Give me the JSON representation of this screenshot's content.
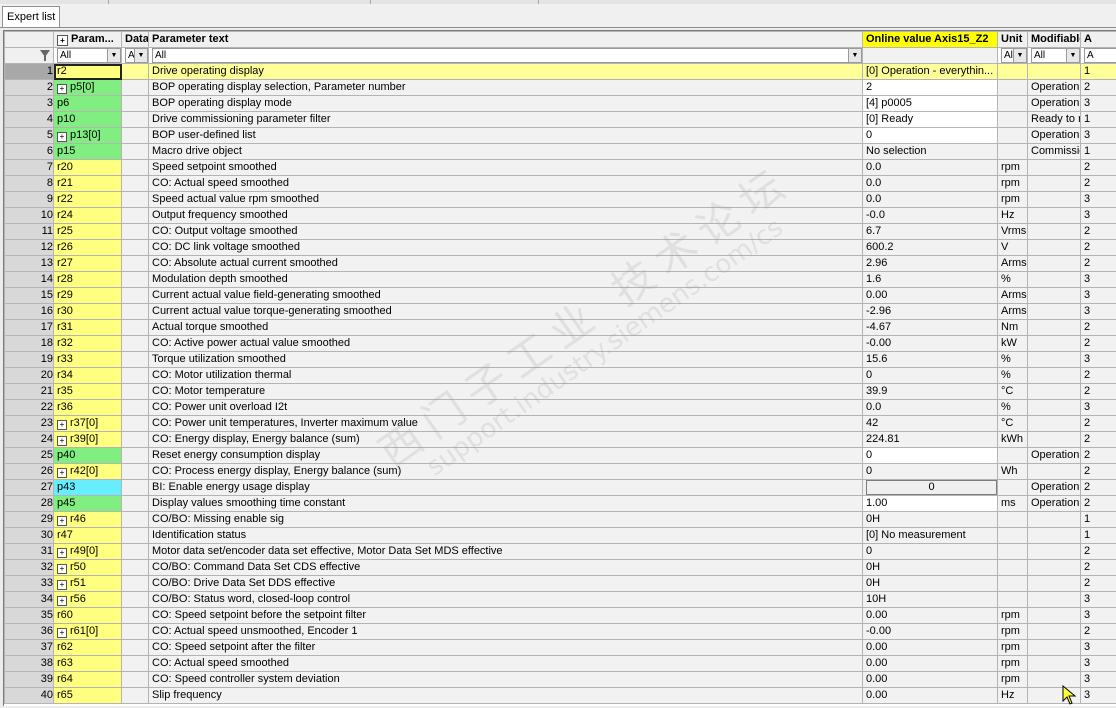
{
  "tab": {
    "label": "Expert list"
  },
  "columns": {
    "param": "Param...",
    "data": "Data",
    "text": "Parameter text",
    "online": "Online value Axis15_Z2",
    "unit": "Unit",
    "mod": "Modifiable to",
    "access": "A"
  },
  "filters": {
    "param": "All",
    "data": "A",
    "text": "All",
    "unit": "Al",
    "mod": "All",
    "access": "A"
  },
  "watermark": {
    "line1": "西门子工业 技术论坛",
    "line2": "support.industry.siemens.com/cs"
  },
  "rows": [
    {
      "n": "1",
      "p": "r2",
      "pc": "y",
      "t": "Drive operating display",
      "v": "[0] Operation - everythin...",
      "u": "",
      "m": "",
      "a": "1"
    },
    {
      "n": "2",
      "p": "p5[0]",
      "pc": "g",
      "x": "1",
      "t": "BOP operating display selection, Parameter number",
      "v": "2",
      "vw": "1",
      "u": "",
      "m": "Operation",
      "a": "2"
    },
    {
      "n": "3",
      "p": "p6",
      "pc": "g",
      "t": "BOP operating display mode",
      "v": "[4] p0005",
      "vw": "1",
      "u": "",
      "m": "Operation",
      "a": "3"
    },
    {
      "n": "4",
      "p": "p10",
      "pc": "g",
      "t": "Drive commissioning parameter filter",
      "v": "[0] Ready",
      "vw": "1",
      "u": "",
      "m": "Ready to run",
      "a": "1"
    },
    {
      "n": "5",
      "p": "p13[0]",
      "pc": "g",
      "x": "1",
      "t": "BOP user-defined list",
      "v": "0",
      "vw": "1",
      "u": "",
      "m": "Operation",
      "a": "3"
    },
    {
      "n": "6",
      "p": "p15",
      "pc": "g",
      "t": "Macro drive object",
      "v": "No selection",
      "u": "",
      "m": "Commissionin...",
      "a": "1"
    },
    {
      "n": "7",
      "p": "r20",
      "pc": "y",
      "t": "Speed setpoint smoothed",
      "v": "0.0",
      "u": "rpm",
      "m": "",
      "a": "2"
    },
    {
      "n": "8",
      "p": "r21",
      "pc": "y",
      "t": "CO: Actual speed smoothed",
      "v": "0.0",
      "u": "rpm",
      "m": "",
      "a": "2"
    },
    {
      "n": "9",
      "p": "r22",
      "pc": "y",
      "t": "Speed actual value rpm smoothed",
      "v": "0.0",
      "u": "rpm",
      "m": "",
      "a": "3"
    },
    {
      "n": "10",
      "p": "r24",
      "pc": "y",
      "t": "Output frequency smoothed",
      "v": "-0.0",
      "u": "Hz",
      "m": "",
      "a": "3"
    },
    {
      "n": "11",
      "p": "r25",
      "pc": "y",
      "t": "CO: Output voltage smoothed",
      "v": "6.7",
      "u": "Vrms",
      "m": "",
      "a": "2"
    },
    {
      "n": "12",
      "p": "r26",
      "pc": "y",
      "t": "CO: DC link voltage smoothed",
      "v": "600.2",
      "u": "V",
      "m": "",
      "a": "2"
    },
    {
      "n": "13",
      "p": "r27",
      "pc": "y",
      "t": "CO: Absolute actual current smoothed",
      "v": "2.96",
      "u": "Arms",
      "m": "",
      "a": "2"
    },
    {
      "n": "14",
      "p": "r28",
      "pc": "y",
      "t": "Modulation depth smoothed",
      "v": "1.6",
      "u": "%",
      "m": "",
      "a": "3"
    },
    {
      "n": "15",
      "p": "r29",
      "pc": "y",
      "t": "Current actual value field-generating smoothed",
      "v": "0.00",
      "u": "Arms",
      "m": "",
      "a": "3"
    },
    {
      "n": "16",
      "p": "r30",
      "pc": "y",
      "t": "Current actual value torque-generating smoothed",
      "v": "-2.96",
      "u": "Arms",
      "m": "",
      "a": "3"
    },
    {
      "n": "17",
      "p": "r31",
      "pc": "y",
      "t": "Actual torque smoothed",
      "v": "-4.67",
      "u": "Nm",
      "m": "",
      "a": "2"
    },
    {
      "n": "18",
      "p": "r32",
      "pc": "y",
      "t": "CO: Active power actual value smoothed",
      "v": "-0.00",
      "u": "kW",
      "m": "",
      "a": "2"
    },
    {
      "n": "19",
      "p": "r33",
      "pc": "y",
      "t": "Torque utilization smoothed",
      "v": "15.6",
      "u": "%",
      "m": "",
      "a": "3"
    },
    {
      "n": "20",
      "p": "r34",
      "pc": "y",
      "t": "CO: Motor utilization thermal",
      "v": "0",
      "u": "%",
      "m": "",
      "a": "2"
    },
    {
      "n": "21",
      "p": "r35",
      "pc": "y",
      "t": "CO: Motor temperature",
      "v": "39.9",
      "u": "°C",
      "m": "",
      "a": "2"
    },
    {
      "n": "22",
      "p": "r36",
      "pc": "y",
      "t": "CO: Power unit overload I2t",
      "v": "0.0",
      "u": "%",
      "m": "",
      "a": "3"
    },
    {
      "n": "23",
      "p": "r37[0]",
      "pc": "y",
      "x": "1",
      "t": "CO: Power unit temperatures, Inverter maximum value",
      "v": "42",
      "u": "°C",
      "m": "",
      "a": "2"
    },
    {
      "n": "24",
      "p": "r39[0]",
      "pc": "y",
      "x": "1",
      "t": "CO: Energy display, Energy balance (sum)",
      "v": "224.81",
      "u": "kWh",
      "m": "",
      "a": "2"
    },
    {
      "n": "25",
      "p": "p40",
      "pc": "g",
      "t": "Reset energy consumption display",
      "v": "0",
      "vw": "1",
      "u": "",
      "m": "Operation",
      "a": "2"
    },
    {
      "n": "26",
      "p": "r42[0]",
      "pc": "y",
      "x": "1",
      "t": "CO: Process energy display, Energy balance (sum)",
      "v": "0",
      "u": "Wh",
      "m": "",
      "a": "2"
    },
    {
      "n": "27",
      "p": "p43",
      "pc": "c",
      "t": "BI: Enable energy usage display",
      "v": "0",
      "vb": "1",
      "u": "",
      "m": "Operation",
      "a": "2"
    },
    {
      "n": "28",
      "p": "p45",
      "pc": "g",
      "t": "Display values smoothing time constant",
      "v": "1.00",
      "vw": "1",
      "u": "ms",
      "m": "Operation",
      "a": "2"
    },
    {
      "n": "29",
      "p": "r46",
      "pc": "y",
      "x": "1",
      "t": "CO/BO: Missing enable sig",
      "v": "0H",
      "u": "",
      "m": "",
      "a": "1"
    },
    {
      "n": "30",
      "p": "r47",
      "pc": "y",
      "t": "Identification status",
      "v": "[0] No measurement",
      "u": "",
      "m": "",
      "a": "1"
    },
    {
      "n": "31",
      "p": "r49[0]",
      "pc": "y",
      "x": "1",
      "t": "Motor data set/encoder data set effective, Motor Data Set MDS effective",
      "v": "0",
      "u": "",
      "m": "",
      "a": "2"
    },
    {
      "n": "32",
      "p": "r50",
      "pc": "y",
      "x": "1",
      "t": "CO/BO: Command Data Set CDS effective",
      "v": "0H",
      "u": "",
      "m": "",
      "a": "2"
    },
    {
      "n": "33",
      "p": "r51",
      "pc": "y",
      "x": "1",
      "t": "CO/BO: Drive Data Set DDS effective",
      "v": "0H",
      "u": "",
      "m": "",
      "a": "2"
    },
    {
      "n": "34",
      "p": "r56",
      "pc": "y",
      "x": "1",
      "t": "CO/BO: Status word, closed-loop control",
      "v": "10H",
      "u": "",
      "m": "",
      "a": "3"
    },
    {
      "n": "35",
      "p": "r60",
      "pc": "y",
      "t": "CO: Speed setpoint before the setpoint filter",
      "v": "0.00",
      "u": "rpm",
      "m": "",
      "a": "3"
    },
    {
      "n": "36",
      "p": "r61[0]",
      "pc": "y",
      "x": "1",
      "t": "CO: Actual speed unsmoothed, Encoder 1",
      "v": "-0.00",
      "u": "rpm",
      "m": "",
      "a": "2"
    },
    {
      "n": "37",
      "p": "r62",
      "pc": "y",
      "t": "CO: Speed setpoint after the filter",
      "v": "0.00",
      "u": "rpm",
      "m": "",
      "a": "3"
    },
    {
      "n": "38",
      "p": "r63",
      "pc": "y",
      "t": "CO: Actual speed smoothed",
      "v": "0.00",
      "u": "rpm",
      "m": "",
      "a": "3"
    },
    {
      "n": "39",
      "p": "r64",
      "pc": "y",
      "t": "CO: Speed controller system deviation",
      "v": "0.00",
      "u": "rpm",
      "m": "",
      "a": "3"
    },
    {
      "n": "40",
      "p": "r65",
      "pc": "y",
      "t": "Slip frequency",
      "v": "0.00",
      "u": "Hz",
      "m": "",
      "a": "3"
    }
  ]
}
